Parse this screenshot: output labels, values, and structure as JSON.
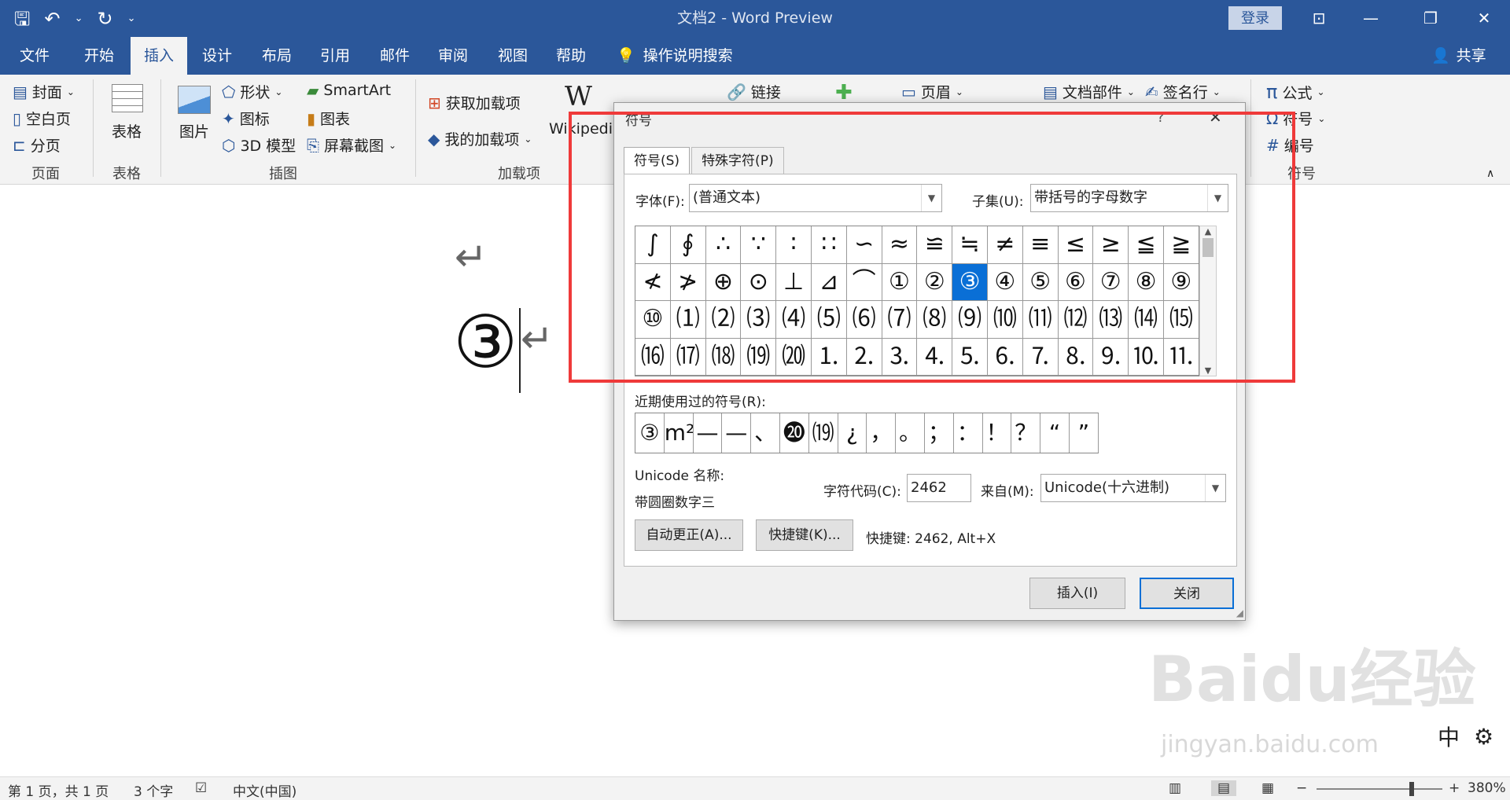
{
  "titlebar": {
    "doc_title": "文档2  -  Word Preview",
    "login_label": "登录",
    "qat": {
      "save": "🖫",
      "undo": "↶",
      "undo_arrow": "⌄",
      "redo": "↻",
      "customize": "⌄"
    },
    "win": {
      "ribbon_opts": "⊡",
      "minimize": "—",
      "restore": "❐",
      "close": "✕"
    }
  },
  "menu": {
    "tabs": [
      "文件",
      "开始",
      "插入",
      "设计",
      "布局",
      "引用",
      "邮件",
      "审阅",
      "视图",
      "帮助"
    ],
    "search": "操作说明搜索",
    "share": "共享"
  },
  "ribbon": {
    "pages": {
      "cover": "封面",
      "blank": "空白页",
      "break": "分页",
      "label": "页面"
    },
    "tables": {
      "table": "表格",
      "label": "表格"
    },
    "illustrations": {
      "picture": "图片",
      "shapes": "形状",
      "icons": "图标",
      "model3d": "3D 模型",
      "smartart": "SmartArt",
      "chart": "图表",
      "screenshot": "屏幕截图",
      "label": "插图"
    },
    "addins": {
      "get": "获取加载项",
      "my": "我的加载项",
      "wiki": "Wikipedia",
      "label": "加载项"
    },
    "links": {
      "link": "链接"
    },
    "header": {
      "header": "页眉"
    },
    "text": {
      "parts": "文档部件",
      "signature": "签名行"
    },
    "symbols": {
      "equation": "公式",
      "symbol": "符号",
      "number": "编号",
      "label": "符号"
    }
  },
  "document": {
    "return1": "↵",
    "circled3": "③",
    "return2": "↵"
  },
  "dialog": {
    "title": "符号",
    "help": "?",
    "close": "✕",
    "tab_symbols": "符号(S)",
    "tab_special": "特殊字符(P)",
    "font_label": "字体(F):",
    "font_value": "(普通文本)",
    "subset_label": "子集(U):",
    "subset_value": "带括号的字母数字",
    "grid": [
      "∫",
      "∮",
      "∴",
      "∵",
      "∶",
      "∷",
      "∽",
      "≈",
      "≌",
      "≒",
      "≠",
      "≡",
      "≤",
      "≥",
      "≦",
      "≧",
      "≮",
      "≯",
      "⊕",
      "⊙",
      "⊥",
      "⊿",
      "⌒",
      "①",
      "②",
      "③",
      "④",
      "⑤",
      "⑥",
      "⑦",
      "⑧",
      "⑨",
      "⑩",
      "⑴",
      "⑵",
      "⑶",
      "⑷",
      "⑸",
      "⑹",
      "⑺",
      "⑻",
      "⑼",
      "⑽",
      "⑾",
      "⑿",
      "⒀",
      "⒁",
      "⒂",
      "⒃",
      "⒄",
      "⒅",
      "⒆",
      "⒇",
      "⒈",
      "⒉",
      "⒊",
      "⒋",
      "⒌",
      "⒍",
      "⒎",
      "⒏",
      "⒐",
      "⒑",
      "⒒"
    ],
    "recent_label": "近期使用过的符号(R):",
    "recent": [
      "③",
      "m²",
      "—",
      "—",
      "、",
      "⓴",
      "⒆",
      "¿",
      "，",
      "。",
      "；",
      "：",
      "！",
      "？",
      "“",
      "”"
    ],
    "unicode_name_label": "Unicode 名称:",
    "unicode_name": "带圆圈数字三",
    "code_label": "字符代码(C):",
    "code_value": "2462",
    "from_label": "来自(M):",
    "from_value": "Unicode(十六进制)",
    "autocorrect": "自动更正(A)...",
    "shortcut_btn": "快捷键(K)...",
    "shortcut_text": "快捷键: 2462, Alt+X",
    "insert": "插入(I)",
    "close_btn": "关闭"
  },
  "status": {
    "page": "第 1 页，共 1 页",
    "words": "3 个字",
    "lang": "中文(中国)",
    "zoom": "380%"
  },
  "ime": {
    "mode": "中",
    "gear": "⚙"
  },
  "watermark": {
    "brand": "Baidu经验",
    "url": "jingyan.baidu.com"
  }
}
